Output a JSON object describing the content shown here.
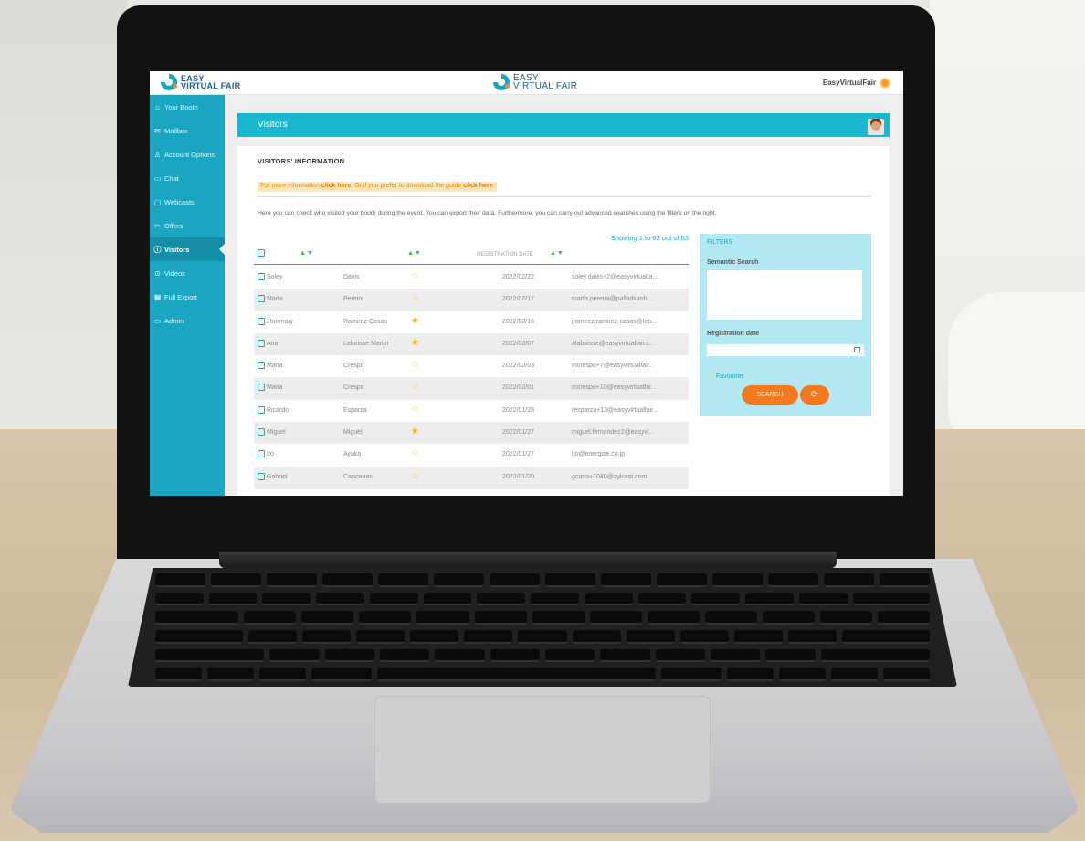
{
  "header": {
    "logo_left_line1": "EASY",
    "logo_left_line2": "VIRTUAL FAIR",
    "logo_center_line1": "EASY",
    "logo_center_line2": "VIRTUAL FAIR",
    "user_name": "EasyVirtualFair"
  },
  "sidebar": {
    "items": [
      {
        "label": "Your Booth",
        "icon": "⌂"
      },
      {
        "label": "Mailbox",
        "icon": "✉"
      },
      {
        "label": "Account Options",
        "icon": "♙"
      },
      {
        "label": "Chat",
        "icon": "▭"
      },
      {
        "label": "Webcasts",
        "icon": "▢"
      },
      {
        "label": "Offers",
        "icon": "✂"
      },
      {
        "label": "Visitors",
        "icon": "ⓘ"
      },
      {
        "label": "Videos",
        "icon": "⊙"
      },
      {
        "label": "Full Export",
        "icon": "▦"
      },
      {
        "label": "Admin",
        "icon": "▭"
      }
    ]
  },
  "page": {
    "title": "Visitors",
    "section_title": "VISITORS' INFORMATION",
    "banner_pre": "For more information ",
    "banner_link1": "click here",
    "banner_mid": ". Or if you prefer to download the guide ",
    "banner_link2": "click here",
    "banner_post": ".",
    "description": "Here you can check who visited your booth during the event. You can export their data. Furthermore, you can carry out advanced searches using the filters on the right."
  },
  "table": {
    "showing": "Showing 1 to 63 out of 63",
    "sort_arrows": "▲▼",
    "col_registration_date": "REGISTRATION DATE",
    "rows": [
      {
        "first": "Soley",
        "last": "Davis",
        "fav": false,
        "date": "2022/02/22",
        "email": "soley.davis+2@easyvirtualfa..."
      },
      {
        "first": "Marta",
        "last": "Pereira",
        "fav": false,
        "date": "2022/02/17",
        "email": "marta.pereira@palladiumh..."
      },
      {
        "first": "Jhormary",
        "last": "Ramirez Casas",
        "fav": true,
        "date": "2022/02/16",
        "email": "jramirez.ramirez-casas@leo..."
      },
      {
        "first": "Ana",
        "last": "Laboisse Martin",
        "fav": true,
        "date": "2022/02/07",
        "email": "alaboisse@easyvirtualfair.c..."
      },
      {
        "first": "Maria",
        "last": "Crespo",
        "fav": false,
        "date": "2022/02/03",
        "email": "mcrespo+7@easyvirtualfair..."
      },
      {
        "first": "Maria",
        "last": "Crespo",
        "fav": false,
        "date": "2022/02/01",
        "email": "mcrespo+10@easyvirtualfai..."
      },
      {
        "first": "Ricardo",
        "last": "Esparza",
        "fav": false,
        "date": "2022/01/28",
        "email": "resparza+13@easyvirtualfair..."
      },
      {
        "first": "Miguel",
        "last": "Miguel",
        "fav": true,
        "date": "2022/01/27",
        "email": "miguel.fernandez2@easyvi..."
      },
      {
        "first": "Ito",
        "last": "Ayaka",
        "fav": false,
        "date": "2022/01/27",
        "email": "ito@energize.co.jp"
      },
      {
        "first": "Gabriel",
        "last": "Canoaaas",
        "fav": false,
        "date": "2022/01/20",
        "email": "gcano+1040@zylcast.com"
      }
    ]
  },
  "filters": {
    "title": "FILTERS",
    "semantic_label": "Semantic Search",
    "date_label": "Registration date",
    "favourite_label": "Favourite",
    "search_button": "SEARCH",
    "reset_icon": "⟳"
  },
  "colors": {
    "accent": "#1aa6c2",
    "orange": "#f47a20",
    "star": "#f5b400"
  }
}
